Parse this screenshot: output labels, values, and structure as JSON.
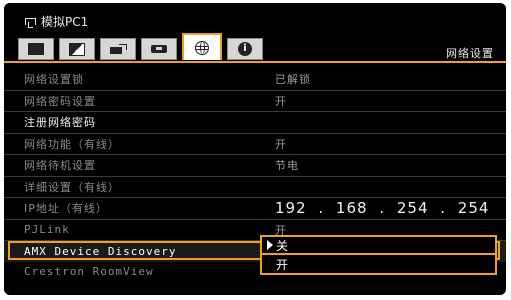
{
  "header": {
    "source_label": "模拟PC1",
    "menu_title": "网络设置",
    "tabs": [
      {
        "icon": "image-icon"
      },
      {
        "icon": "adjust-icon"
      },
      {
        "icon": "install-icon"
      },
      {
        "icon": "system-icon"
      },
      {
        "icon": "network-globe-icon",
        "active": true
      },
      {
        "icon": "info-icon"
      }
    ]
  },
  "settings": [
    {
      "label": "网络设置锁",
      "value": "已解锁"
    },
    {
      "label": "网络密码设置",
      "value": "开"
    },
    {
      "label": "注册网络密码",
      "value": ""
    },
    {
      "label": "网络功能（有线）",
      "value": "开"
    },
    {
      "label": "网络待机设置",
      "value": "节电"
    },
    {
      "label": "详细设置（有线）",
      "value": ""
    },
    {
      "label": "IP地址（有线）",
      "value": "192 . 168 . 254 . 254"
    },
    {
      "label": "PJLink",
      "value": "开"
    },
    {
      "label": "AMX Device Discovery",
      "value": ""
    },
    {
      "label": "Crestron RoomView",
      "value": ""
    }
  ],
  "dropdown": {
    "options": [
      "关",
      "开"
    ],
    "selected": "关"
  },
  "colors": {
    "accent": "#f0a020",
    "background": "#000000"
  }
}
